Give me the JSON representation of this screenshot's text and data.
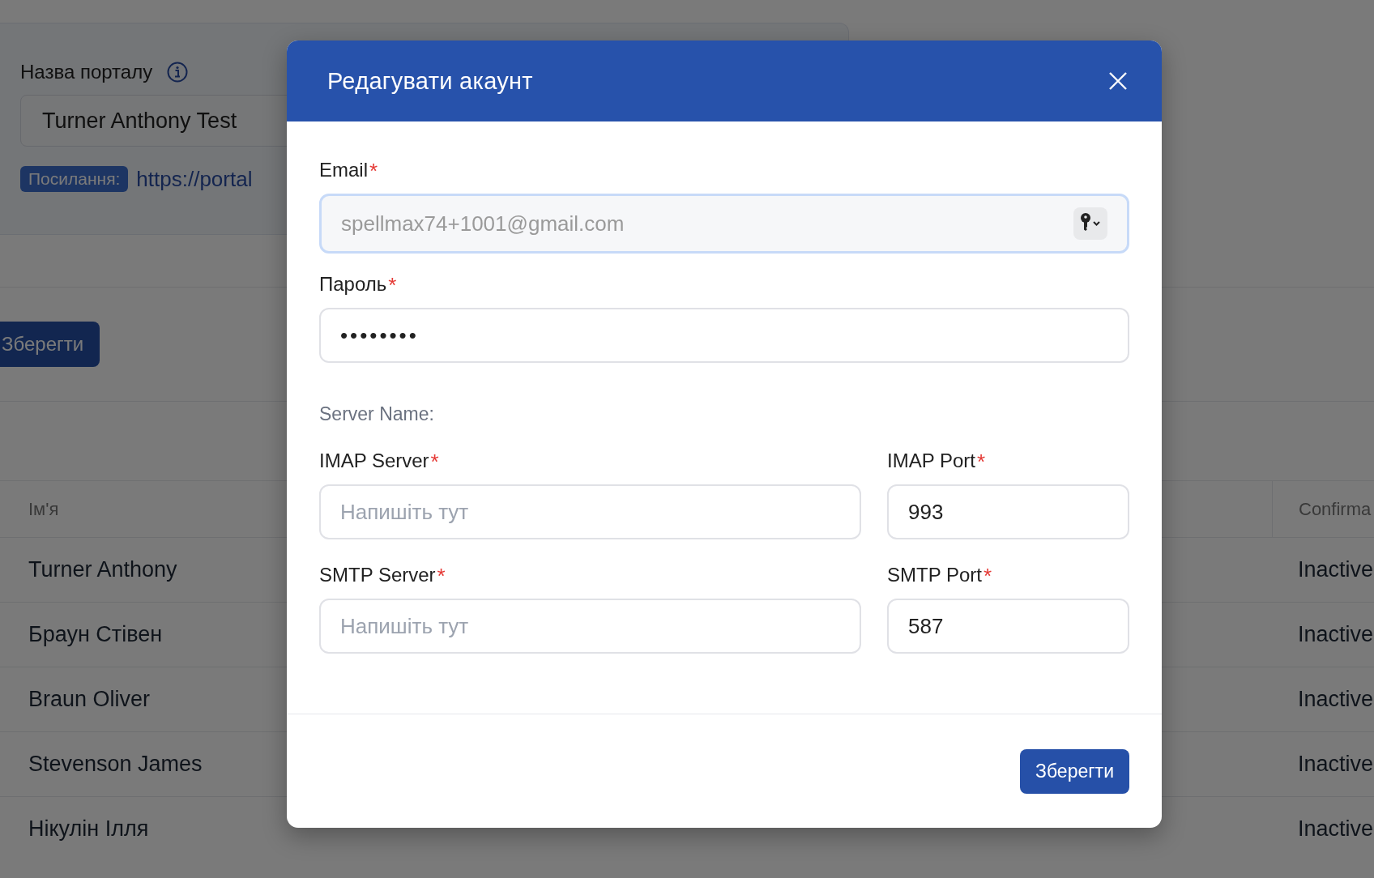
{
  "background": {
    "portal_name": {
      "label": "Назва порталу",
      "value": "Turner Anthony Test"
    },
    "link": {
      "label": "Посилання:",
      "url": "https://portal"
    },
    "save_button": "Зберегти",
    "table": {
      "columns": [
        "Ім'я",
        "Confirma"
      ],
      "rows": [
        {
          "name": "Turner Anthony",
          "status": "Inactive"
        },
        {
          "name": "Браун Стівен",
          "status": "Inactive"
        },
        {
          "name": "Braun Oliver",
          "status": "Inactive"
        },
        {
          "name": "Stevenson James",
          "status": "Inactive"
        },
        {
          "name": "Нікулін Ілля",
          "status": "Inactive"
        }
      ]
    }
  },
  "dialog": {
    "title": "Редагувати акаунт",
    "fields": [
      {
        "label": "Email",
        "required_mark": "*",
        "value": "spellmax74+1001@gmail.com",
        "focused": true
      },
      {
        "label": "Пароль",
        "required_mark": "*",
        "value": "••••••••",
        "focused": false
      }
    ],
    "section_label": "Server Name:",
    "server_fields": [
      {
        "label": "IMAP Server",
        "required_mark": "*",
        "placeholder": "Напишіть тут"
      },
      {
        "label": "IMAP Port",
        "required_mark": "*",
        "value": "993"
      },
      {
        "label": "SMTP Server",
        "required_mark": "*",
        "placeholder": "Напишіть тут"
      },
      {
        "label": "SMTP Port",
        "required_mark": "*",
        "value": "587"
      }
    ],
    "save_button": "Зберегти"
  }
}
